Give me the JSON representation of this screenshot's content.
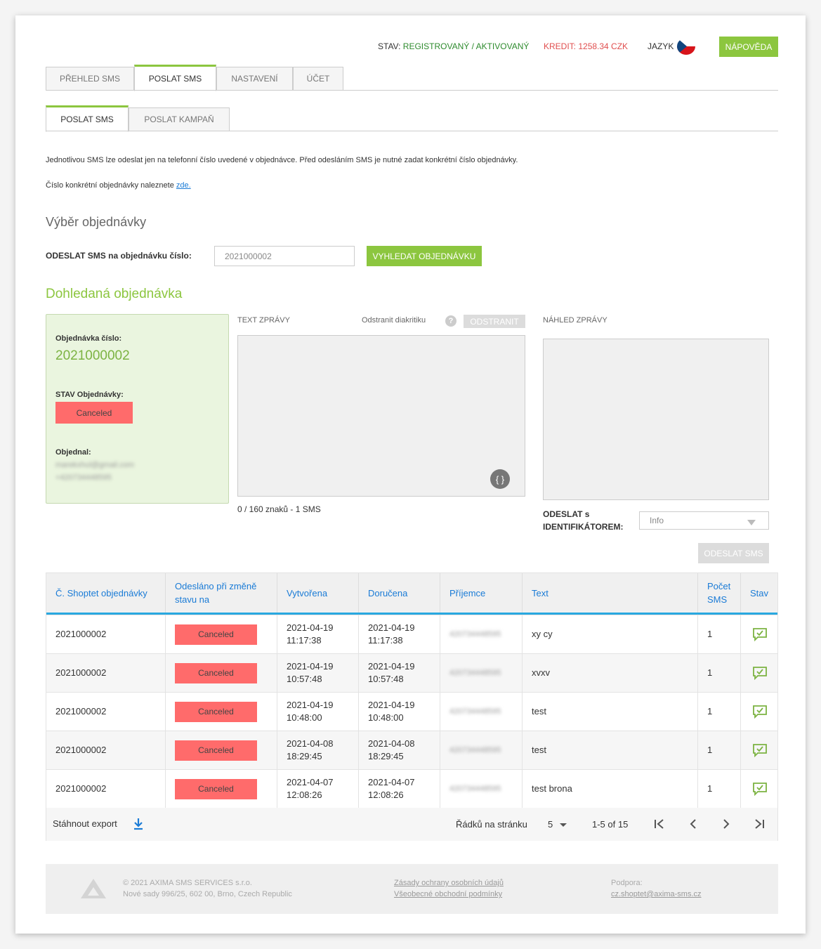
{
  "header": {
    "status_label": "STAV:",
    "status_value": "REGISTROVANÝ / AKTIVOVANÝ",
    "credit": "KREDIT: 1258.34 CZK",
    "language_label": "JAZYK",
    "help_button": "NÁPOVĚDA"
  },
  "main_tabs": [
    {
      "label": "PŘEHLED SMS"
    },
    {
      "label": "POSLAT SMS"
    },
    {
      "label": "NASTAVENÍ"
    },
    {
      "label": "ÚČET"
    }
  ],
  "sub_tabs": [
    {
      "label": "POSLAT SMS"
    },
    {
      "label": "POSLAT KAMPAŇ"
    }
  ],
  "intro": {
    "line1": "Jednotlivou SMS lze odeslat jen na telefonní číslo uvedené v objednávce. Před odesláním SMS je nutné zadat konkrétní číslo objednávky.",
    "line2_prefix": "Číslo konkrétní objednávky naleznete",
    "line2_link": "zde."
  },
  "order_select": {
    "heading": "Výběr objednávky",
    "label": "ODESLAT SMS na objednávku číslo:",
    "input_value": "2021000002",
    "search_button": "VYHLEDAT OBJEDNÁVKU"
  },
  "found_order": {
    "heading": "Dohledaná objednávka",
    "number_label": "Objednávka číslo:",
    "number": "2021000002",
    "status_label": "STAV Objednávky:",
    "status": "Canceled",
    "ordered_by_label": "Objednal:",
    "email": "marekxhul@gmail.com",
    "phone": "+420734448595"
  },
  "message": {
    "text_label": "TEXT ZPRÁVY",
    "remove_diacritics_label": "Odstranit diakritiku",
    "remove_button": "ODSTRANIT",
    "counter": "0 / 160 znaků - 1 SMS",
    "preview_label": "NÁHLED ZPRÁVY",
    "sender_label_1": "ODESLAT s",
    "sender_label_2": "IDENTIFIKÁTOREM:",
    "sender_value": "Info",
    "send_button": "ODESLAT SMS"
  },
  "table": {
    "headers": [
      "Č. Shoptet objednávky",
      "Odesláno při změně stavu na",
      "Vytvořena",
      "Doručena",
      "Příjemce",
      "Text",
      "Počet SMS",
      "Stav"
    ],
    "rows": [
      {
        "order": "2021000002",
        "status": "Canceled",
        "created_date": "2021-04-19",
        "created_time": "11:17:38",
        "delivered_date": "2021-04-19",
        "delivered_time": "11:17:38",
        "recipient": "420734448595",
        "text": "xy cy",
        "count": "1"
      },
      {
        "order": "2021000002",
        "status": "Canceled",
        "created_date": "2021-04-19",
        "created_time": "10:57:48",
        "delivered_date": "2021-04-19",
        "delivered_time": "10:57:48",
        "recipient": "420734448595",
        "text": "xvxv",
        "count": "1"
      },
      {
        "order": "2021000002",
        "status": "Canceled",
        "created_date": "2021-04-19",
        "created_time": "10:48:00",
        "delivered_date": "2021-04-19",
        "delivered_time": "10:48:00",
        "recipient": "420734448595",
        "text": "test",
        "count": "1"
      },
      {
        "order": "2021000002",
        "status": "Canceled",
        "created_date": "2021-04-08",
        "created_time": "18:29:45",
        "delivered_date": "2021-04-08",
        "delivered_time": "18:29:45",
        "recipient": "420734448595",
        "text": "test",
        "count": "1"
      },
      {
        "order": "2021000002",
        "status": "Canceled",
        "created_date": "2021-04-07",
        "created_time": "12:08:26",
        "delivered_date": "2021-04-07",
        "delivered_time": "12:08:26",
        "recipient": "420734448595",
        "text": "test brona",
        "count": "1"
      }
    ],
    "export_label": "Stáhnout export",
    "rows_per_page_label": "Řádků na stránku",
    "rows_per_page_value": "5",
    "range": "1-5 of 15"
  },
  "footer": {
    "copyright": "© 2021 AXIMA SMS SERVICES s.r.o.",
    "address": "Nové sady 996/25, 602 00, Brno, Czech Republic",
    "privacy_link": "Zásady ochrany osobních údajů",
    "terms_link": "Všeobecné obchodní podmínky",
    "support_label": "Podpora:",
    "support_email": "cz.shoptet@axima-sms.cz"
  },
  "colors": {
    "accent_green": "#8cc63f",
    "status_red": "#ff6b6b",
    "link_blue": "#1a7bd6",
    "table_header_line": "#29a8e0"
  }
}
